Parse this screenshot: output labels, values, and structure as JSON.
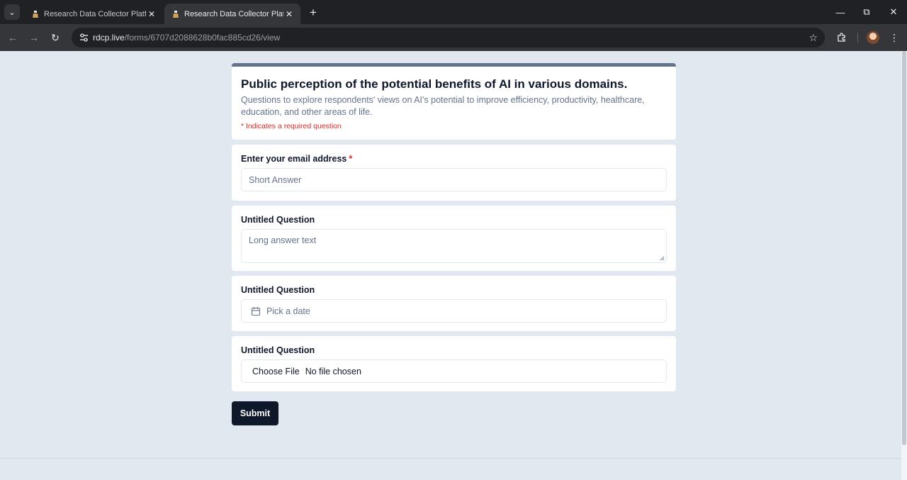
{
  "browser": {
    "tabs": [
      {
        "title": "Research Data Collector Platform",
        "active": false
      },
      {
        "title": "Research Data Collector Platform",
        "active": true
      }
    ],
    "url_host": "rdcp.live",
    "url_path": "/forms/6707d2088628b0fac885cd26/view",
    "icons": {
      "tab_menu": "chevron-down-icon",
      "new_tab": "plus-icon",
      "back": "arrow-left-icon",
      "forward": "arrow-right-icon",
      "reload": "reload-icon",
      "site_info": "tune-icon",
      "bookmark": "star-icon",
      "extensions": "puzzle-icon",
      "menu": "kebab-menu-icon"
    }
  },
  "form": {
    "title": "Public perception of the potential benefits of AI in various domains.",
    "description": "Questions to explore respondents' views on AI's potential to improve efficiency, productivity, healthcare, education, and other areas of life.",
    "required_note": "* Indicates a required question",
    "questions": [
      {
        "label": "Enter your email address",
        "required_mark": "*",
        "type": "short",
        "placeholder": "Short Answer"
      },
      {
        "label": "Untitled Question",
        "type": "long",
        "placeholder": "Long answer text"
      },
      {
        "label": "Untitled Question",
        "type": "date",
        "placeholder": "Pick a date"
      },
      {
        "label": "Untitled Question",
        "type": "file",
        "button_label": "Choose File",
        "status": "No file chosen"
      }
    ],
    "submit_label": "Submit"
  },
  "colors": {
    "page_bg": "#e2e8f0",
    "accent_bar": "#64748b",
    "required": "#dc2626",
    "submit_bg": "#0f172a"
  }
}
